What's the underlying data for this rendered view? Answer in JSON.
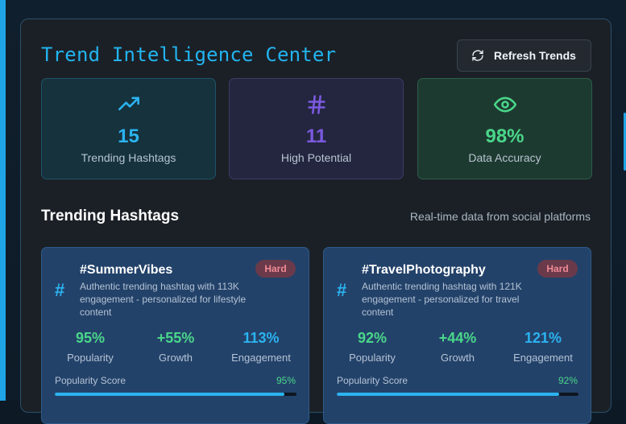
{
  "header": {
    "title": "Trend Intelligence Center",
    "refresh_label": "Refresh Trends",
    "refresh_icon": "refresh-icon"
  },
  "stats": [
    {
      "icon": "trending-up-icon",
      "value": "15",
      "label": "Trending Hashtags",
      "color": "#2bb3f0"
    },
    {
      "icon": "hash-icon",
      "value": "11",
      "label": "High Potential",
      "color": "#7c5ae0"
    },
    {
      "icon": "eye-icon",
      "value": "98%",
      "label": "Data Accuracy",
      "color": "#4ad78a"
    }
  ],
  "section": {
    "title": "Trending Hashtags",
    "subtitle": "Real-time data from social platforms"
  },
  "cards": [
    {
      "tag": "#SummerVibes",
      "badge": "Hard",
      "description": "Authentic trending hashtag with 113K engagement - personalized for lifestyle content",
      "metrics": [
        {
          "value": "95%",
          "label": "Popularity"
        },
        {
          "value": "+55%",
          "label": "Growth"
        },
        {
          "value": "113%",
          "label": "Engagement"
        }
      ],
      "score_label": "Popularity Score",
      "score_value": "95%",
      "score_fraction": 0.95
    },
    {
      "tag": "#TravelPhotography",
      "badge": "Hard",
      "description": "Authentic trending hashtag with 121K engagement - personalized for travel content",
      "metrics": [
        {
          "value": "92%",
          "label": "Popularity"
        },
        {
          "value": "+44%",
          "label": "Growth"
        },
        {
          "value": "121%",
          "label": "Engagement"
        }
      ],
      "score_label": "Popularity Score",
      "score_value": "92%",
      "score_fraction": 0.92
    }
  ],
  "colors": {
    "accent": "#2bb3f0",
    "success": "#4ad78a",
    "purple": "#7c5ae0",
    "badge_hard": "#f08a95"
  }
}
